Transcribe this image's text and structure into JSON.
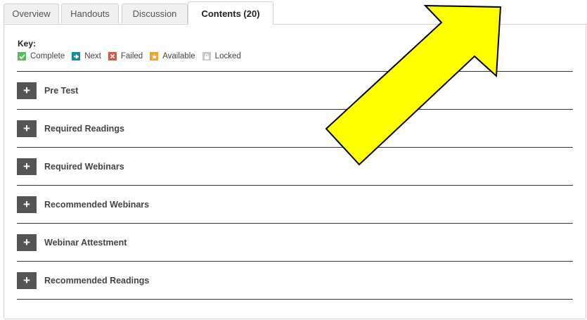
{
  "tabs": [
    {
      "label": "Overview"
    },
    {
      "label": "Handouts"
    },
    {
      "label": "Discussion"
    },
    {
      "label": "Contents (20)"
    }
  ],
  "key": {
    "title": "Key:",
    "items": [
      {
        "label": "Complete",
        "color": "#5cb85c",
        "icon": "check-icon"
      },
      {
        "label": "Next",
        "color": "#1a8a94",
        "icon": "arrow-right-icon"
      },
      {
        "label": "Failed",
        "color": "#d9534f",
        "icon": "x-icon"
      },
      {
        "label": "Available",
        "color": "#f0a030",
        "icon": "star-icon"
      },
      {
        "label": "Locked",
        "color": "#c8c8c8",
        "icon": "lock-icon"
      }
    ]
  },
  "sections": [
    {
      "label": "Pre Test"
    },
    {
      "label": "Required Readings"
    },
    {
      "label": "Required Webinars"
    },
    {
      "label": "Recommended Webinars"
    },
    {
      "label": "Webinar Attestment"
    },
    {
      "label": "Recommended Readings"
    }
  ],
  "expand_symbol": "+",
  "annotation": {
    "color": "#ffff00",
    "stroke": "#000000",
    "icon": "yellow-arrow-annotation"
  }
}
